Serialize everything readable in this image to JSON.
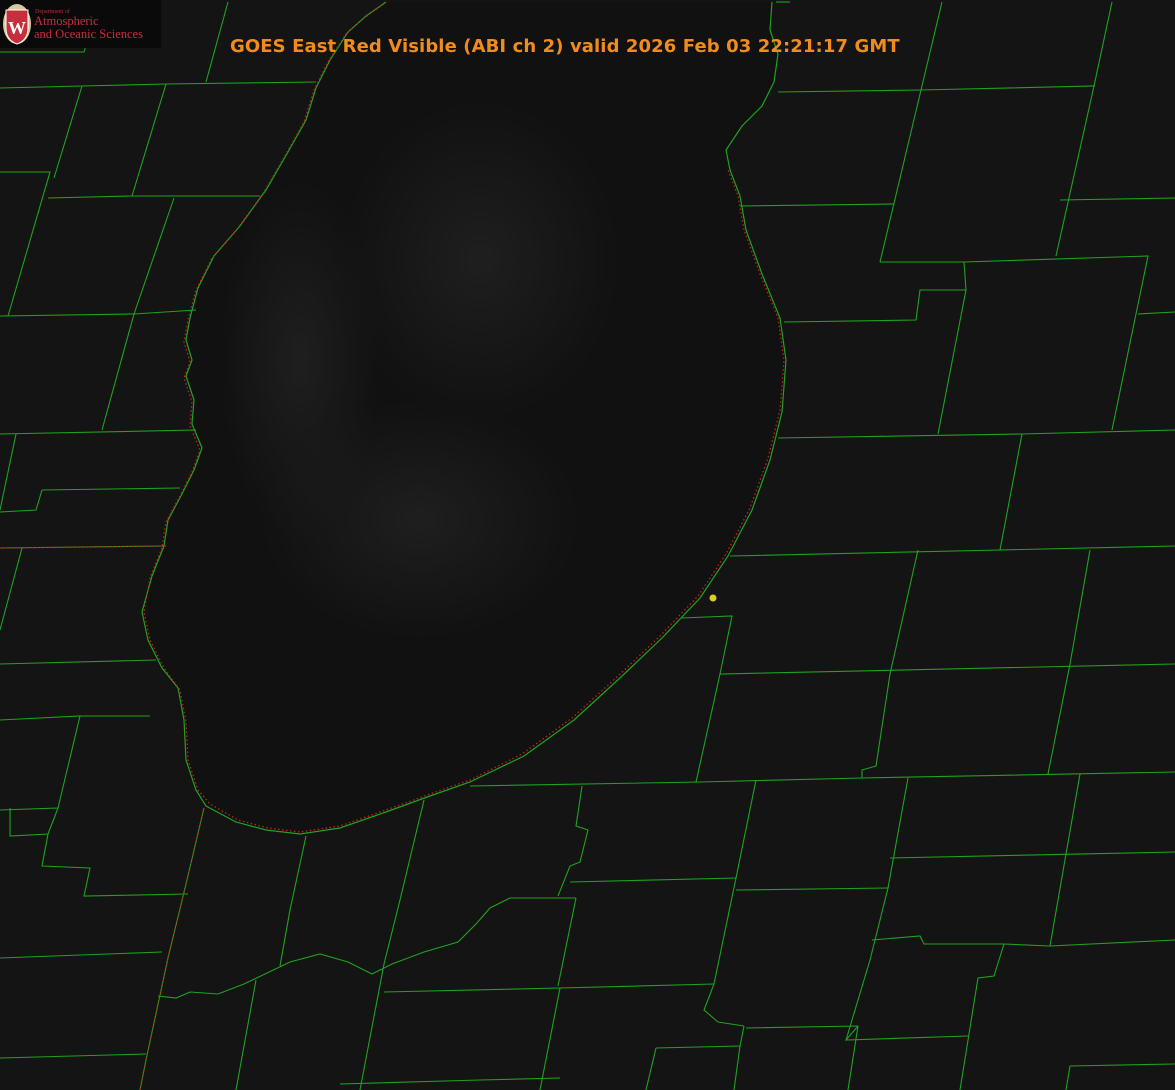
{
  "title": "GOES East Red Visible (ABI ch 2) valid 2026 Feb 03 22:21:17 GMT",
  "logo": {
    "dept": "Department of",
    "line1": "Atmospheric",
    "line2": "and Oceanic Sciences",
    "seal_letter": "W"
  },
  "colors": {
    "background": "#141414",
    "lake": "#101010",
    "county_border": "#1fa21f",
    "coastline_dotted": "#c42020",
    "title": "#f08c1e",
    "logo_text": "#c5303c",
    "station_marker": "#d8d020"
  },
  "map_features": {
    "lake": "lake-michigan-southern-basin",
    "borders": "county-borders",
    "station_marker": "yellow-station-dot"
  }
}
